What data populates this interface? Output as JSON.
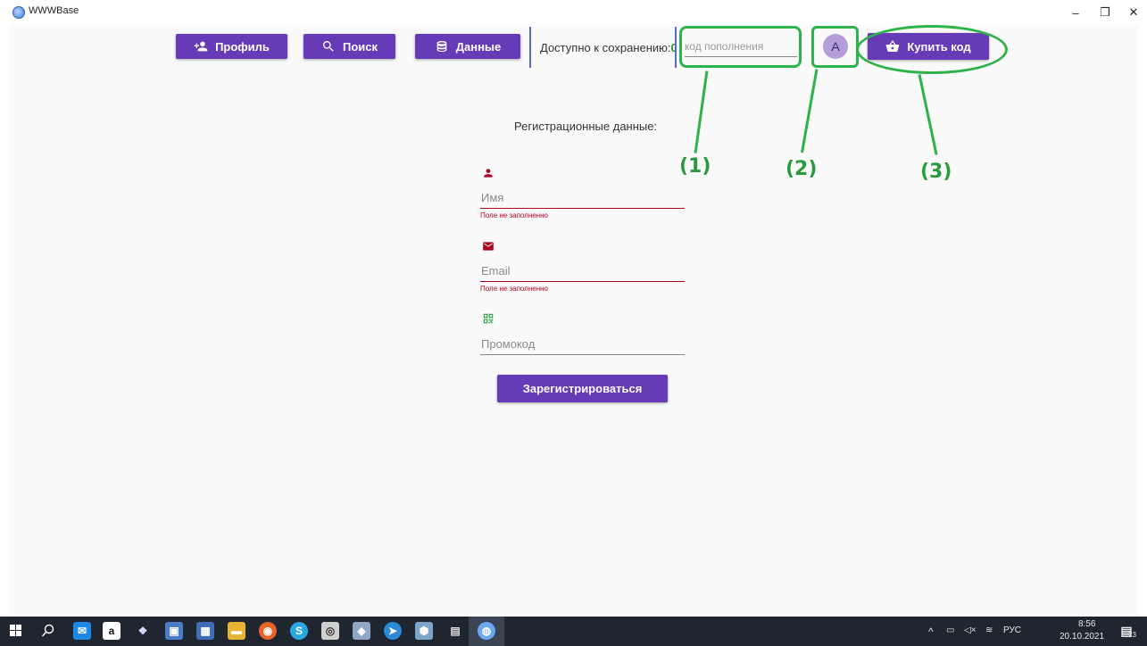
{
  "window": {
    "title": "WWWBase",
    "minimize_glyph": "–",
    "restore_glyph": "❐",
    "close_glyph": "✕"
  },
  "toolbar": {
    "profile_label": "Профиль",
    "search_label": "Поиск",
    "data_label": "Данные",
    "available_label": "Доступно к сохранению:",
    "available_count": "0",
    "topup_placeholder": "код пополнения",
    "avatar_letter": "A",
    "buy_label": "Купить код"
  },
  "annotations": {
    "label_1": "(1)",
    "label_2": "(2)",
    "label_3": "(3)"
  },
  "form": {
    "title": "Регистрационные данные:",
    "name_placeholder": "Имя",
    "name_error": "Поле не заполненно",
    "email_placeholder": "Email",
    "email_error": "Поле не заполненно",
    "promo_placeholder": "Промокод",
    "register_label": "Зарегистрироваться"
  },
  "taskbar": {
    "tray_lang": "РУС",
    "time": "8:56",
    "date": "20.10.2021",
    "notification_count": "23"
  },
  "colors": {
    "accent": "#673ab7",
    "error": "#b00020",
    "annotation": "#2db34a",
    "count": "#1b9e1b"
  }
}
